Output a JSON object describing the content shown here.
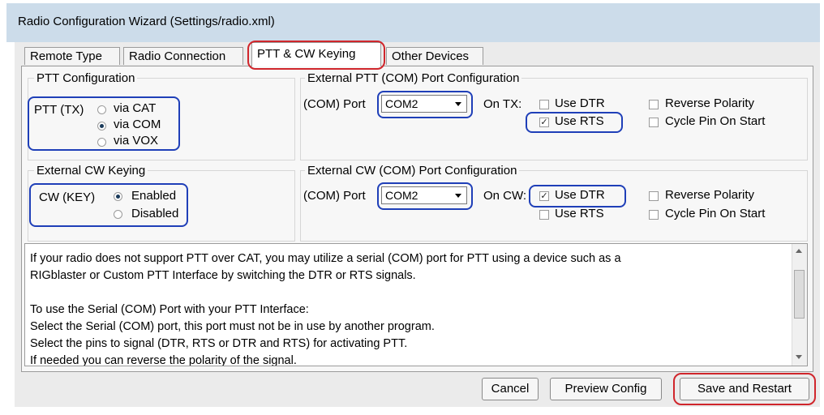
{
  "window": {
    "title": "Radio Configuration Wizard (Settings/radio.xml)"
  },
  "tabs": [
    {
      "label": "Remote Type",
      "active": false
    },
    {
      "label": "Radio Connection",
      "active": false
    },
    {
      "label": "PTT & CW Keying",
      "active": true
    },
    {
      "label": "Other Devices",
      "active": false
    }
  ],
  "ptt_config": {
    "group_label": "PTT Configuration",
    "field_label": "PTT (TX)",
    "options": [
      {
        "label": "via CAT",
        "selected": false
      },
      {
        "label": "via COM",
        "selected": true
      },
      {
        "label": "via VOX",
        "selected": false
      }
    ]
  },
  "ext_ptt": {
    "group_label": "External PTT (COM) Port Configuration",
    "port_label": "(COM) Port",
    "port_value": "COM2",
    "on_label": "On TX:",
    "checkboxes": [
      {
        "label": "Use DTR",
        "checked": false
      },
      {
        "label": "Use RTS",
        "checked": true
      },
      {
        "label": "Reverse Polarity",
        "checked": false
      },
      {
        "label": "Cycle Pin On Start",
        "checked": false
      }
    ]
  },
  "cw_keying": {
    "group_label": "External CW Keying",
    "field_label": "CW (KEY)",
    "options": [
      {
        "label": "Enabled",
        "selected": true
      },
      {
        "label": "Disabled",
        "selected": false
      }
    ]
  },
  "ext_cw": {
    "group_label": "External CW (COM) Port Configuration",
    "port_label": "(COM) Port",
    "port_value": "COM2",
    "on_label": "On CW:",
    "checkboxes": [
      {
        "label": "Use DTR",
        "checked": true
      },
      {
        "label": "Use RTS",
        "checked": false
      },
      {
        "label": "Reverse Polarity",
        "checked": false
      },
      {
        "label": "Cycle Pin On Start",
        "checked": false
      }
    ]
  },
  "info": {
    "lines": [
      "If your radio does not support PTT over CAT, you may utilize a serial (COM) port for PTT using a device such as a",
      "RIGblaster or Custom PTT Interface by switching the DTR or RTS signals.",
      "",
      "To use the Serial (COM) Port with your PTT Interface:",
      "Select the Serial (COM) port, this port must not be in use by another program.",
      "Select the pins to signal (DTR, RTS or DTR and RTS) for activating PTT.",
      "If needed you can reverse the polarity of the signal."
    ]
  },
  "buttons": {
    "cancel": "Cancel",
    "preview": "Preview Config",
    "save": "Save and Restart"
  },
  "colors": {
    "highlight_blue": "#1f3fb8",
    "highlight_red": "#d0262c"
  }
}
